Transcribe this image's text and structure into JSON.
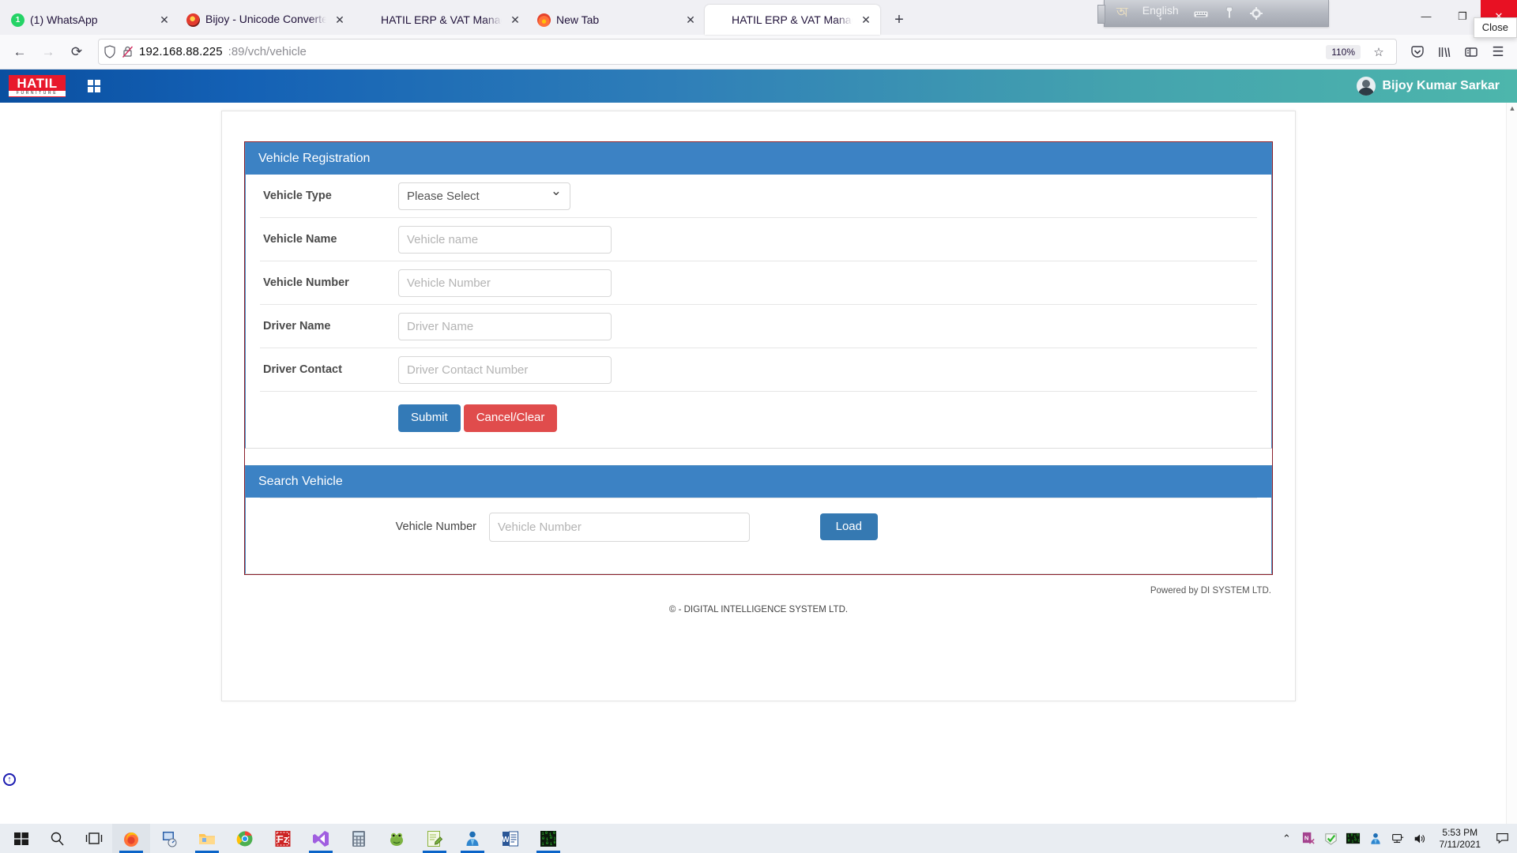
{
  "browser": {
    "tabs": [
      {
        "title": "(1) WhatsApp",
        "favicon": "whatsapp-icon",
        "close": "✕",
        "badge": "1"
      },
      {
        "title": "Bijoy - Unicode Converter | বিজ",
        "favicon": "bijoy-icon",
        "close": "✕"
      },
      {
        "title": "HATIL ERP & VAT Management Syst",
        "favicon": "none",
        "close": "✕"
      },
      {
        "title": "New Tab",
        "favicon": "firefox-icon",
        "close": "✕"
      },
      {
        "title": "HATIL ERP & VAT Management Syst",
        "favicon": "none",
        "close": "✕"
      }
    ],
    "new_tab_label": "+",
    "nav": {
      "back": "←",
      "forward": "→",
      "reload": "⟳",
      "url_host": "192.168.88.225",
      "url_rest": ":89/vch/vehicle",
      "zoom_level": "110%",
      "bookmark": "☆",
      "pocket": "pocket-icon",
      "library": "library-icon",
      "sidebar": "sidebar-icon",
      "menu": "☰"
    },
    "window_controls": {
      "minimize": "—",
      "restore": "❐",
      "close": "✕",
      "close_tooltip": "Close"
    },
    "language_bar": {
      "bangla_glyph": "অ",
      "language": "English",
      "dropdown": "▾",
      "keyboard_icon": "keyboard-icon",
      "tools_icon": "tools-icon",
      "settings_icon": "gear-icon"
    }
  },
  "app": {
    "logo_main": "HATIL",
    "logo_sub": "FURNITURE",
    "user_name": "Bijoy Kumar Sarkar"
  },
  "registration_panel": {
    "title": "Vehicle Registration",
    "fields": [
      {
        "label": "Vehicle Type",
        "type": "select",
        "value": "Please Select",
        "options": [
          "Please Select"
        ]
      },
      {
        "label": "Vehicle Name",
        "type": "text",
        "value": "",
        "placeholder": "Vehicle name"
      },
      {
        "label": "Vehicle Number",
        "type": "text",
        "value": "",
        "placeholder": "Vehicle Number"
      },
      {
        "label": "Driver Name",
        "type": "text",
        "value": "",
        "placeholder": "Driver Name"
      },
      {
        "label": "Driver Contact",
        "type": "text",
        "value": "",
        "placeholder": "Driver Contact Number"
      }
    ],
    "submit_label": "Submit",
    "cancel_label": "Cancel/Clear"
  },
  "search_panel": {
    "title": "Search Vehicle",
    "field_label": "Vehicle Number",
    "field_value": "",
    "field_placeholder": "Vehicle Number",
    "load_label": "Load"
  },
  "footer": {
    "powered_by": "Powered by DI SYSTEM LTD.",
    "copyright": "©  - DIGITAL INTELLIGENCE SYSTEM LTD."
  },
  "scroll_top_label": "↑",
  "taskbar": {
    "start": "start-icon",
    "search": "search-icon",
    "task_view": "task-view-icon",
    "apps": [
      "firefox-icon",
      "remote-desktop-icon",
      "file-explorer-icon",
      "chrome-icon",
      "filezilla-icon",
      "visual-studio-icon",
      "calculator-icon",
      "frog-app-icon",
      "notepad-plus-icon",
      "blue-person-icon",
      "word-icon",
      "matrix-app-icon"
    ],
    "tray": {
      "overflow": "⌃",
      "icons": [
        "onenote-clipper-icon",
        "shield-check-icon",
        "matrix-tray-icon",
        "blue-person-tray-icon",
        "network-icon",
        "volume-icon"
      ],
      "time": "5:53 PM",
      "date": "7/11/2021",
      "notifications": "notification-icon"
    }
  },
  "colors": {
    "panel_header": "#3c82c4",
    "submit": "#337ab7",
    "cancel": "#e04c4c",
    "logo_red": "#e8192c",
    "outer_border": "#8a1f2a",
    "close_red": "#e81123"
  }
}
